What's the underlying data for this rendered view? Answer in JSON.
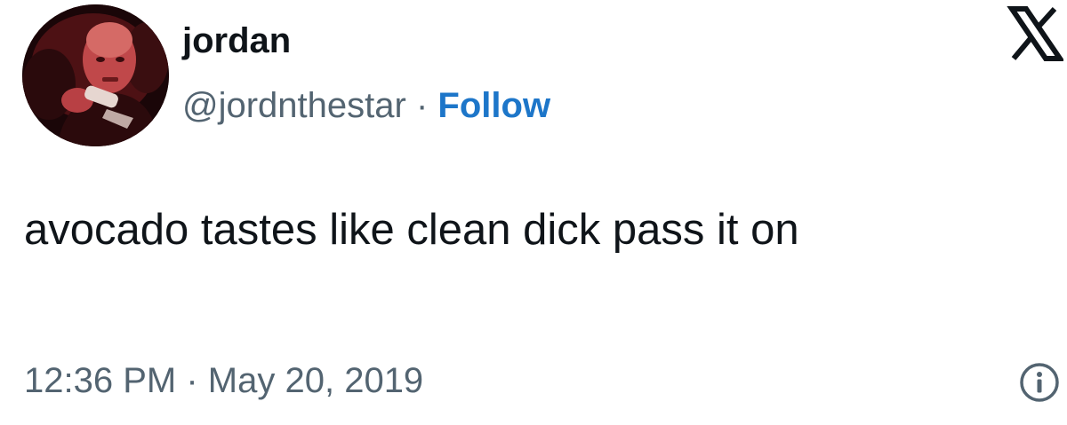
{
  "author": {
    "display_name": "jordan",
    "handle": "@jordnthestar",
    "separator": "·",
    "follow_label": "Follow"
  },
  "tweet": {
    "text": "avocado tastes like clean dick pass it on"
  },
  "meta": {
    "time": "12:36 PM",
    "separator": "·",
    "date": "May 20, 2019"
  },
  "icons": {
    "brand": "x-logo-icon",
    "info": "info-icon"
  },
  "colors": {
    "text": "#0f1419",
    "secondary": "#536471",
    "follow": "#1d76c9",
    "background": "#ffffff"
  }
}
